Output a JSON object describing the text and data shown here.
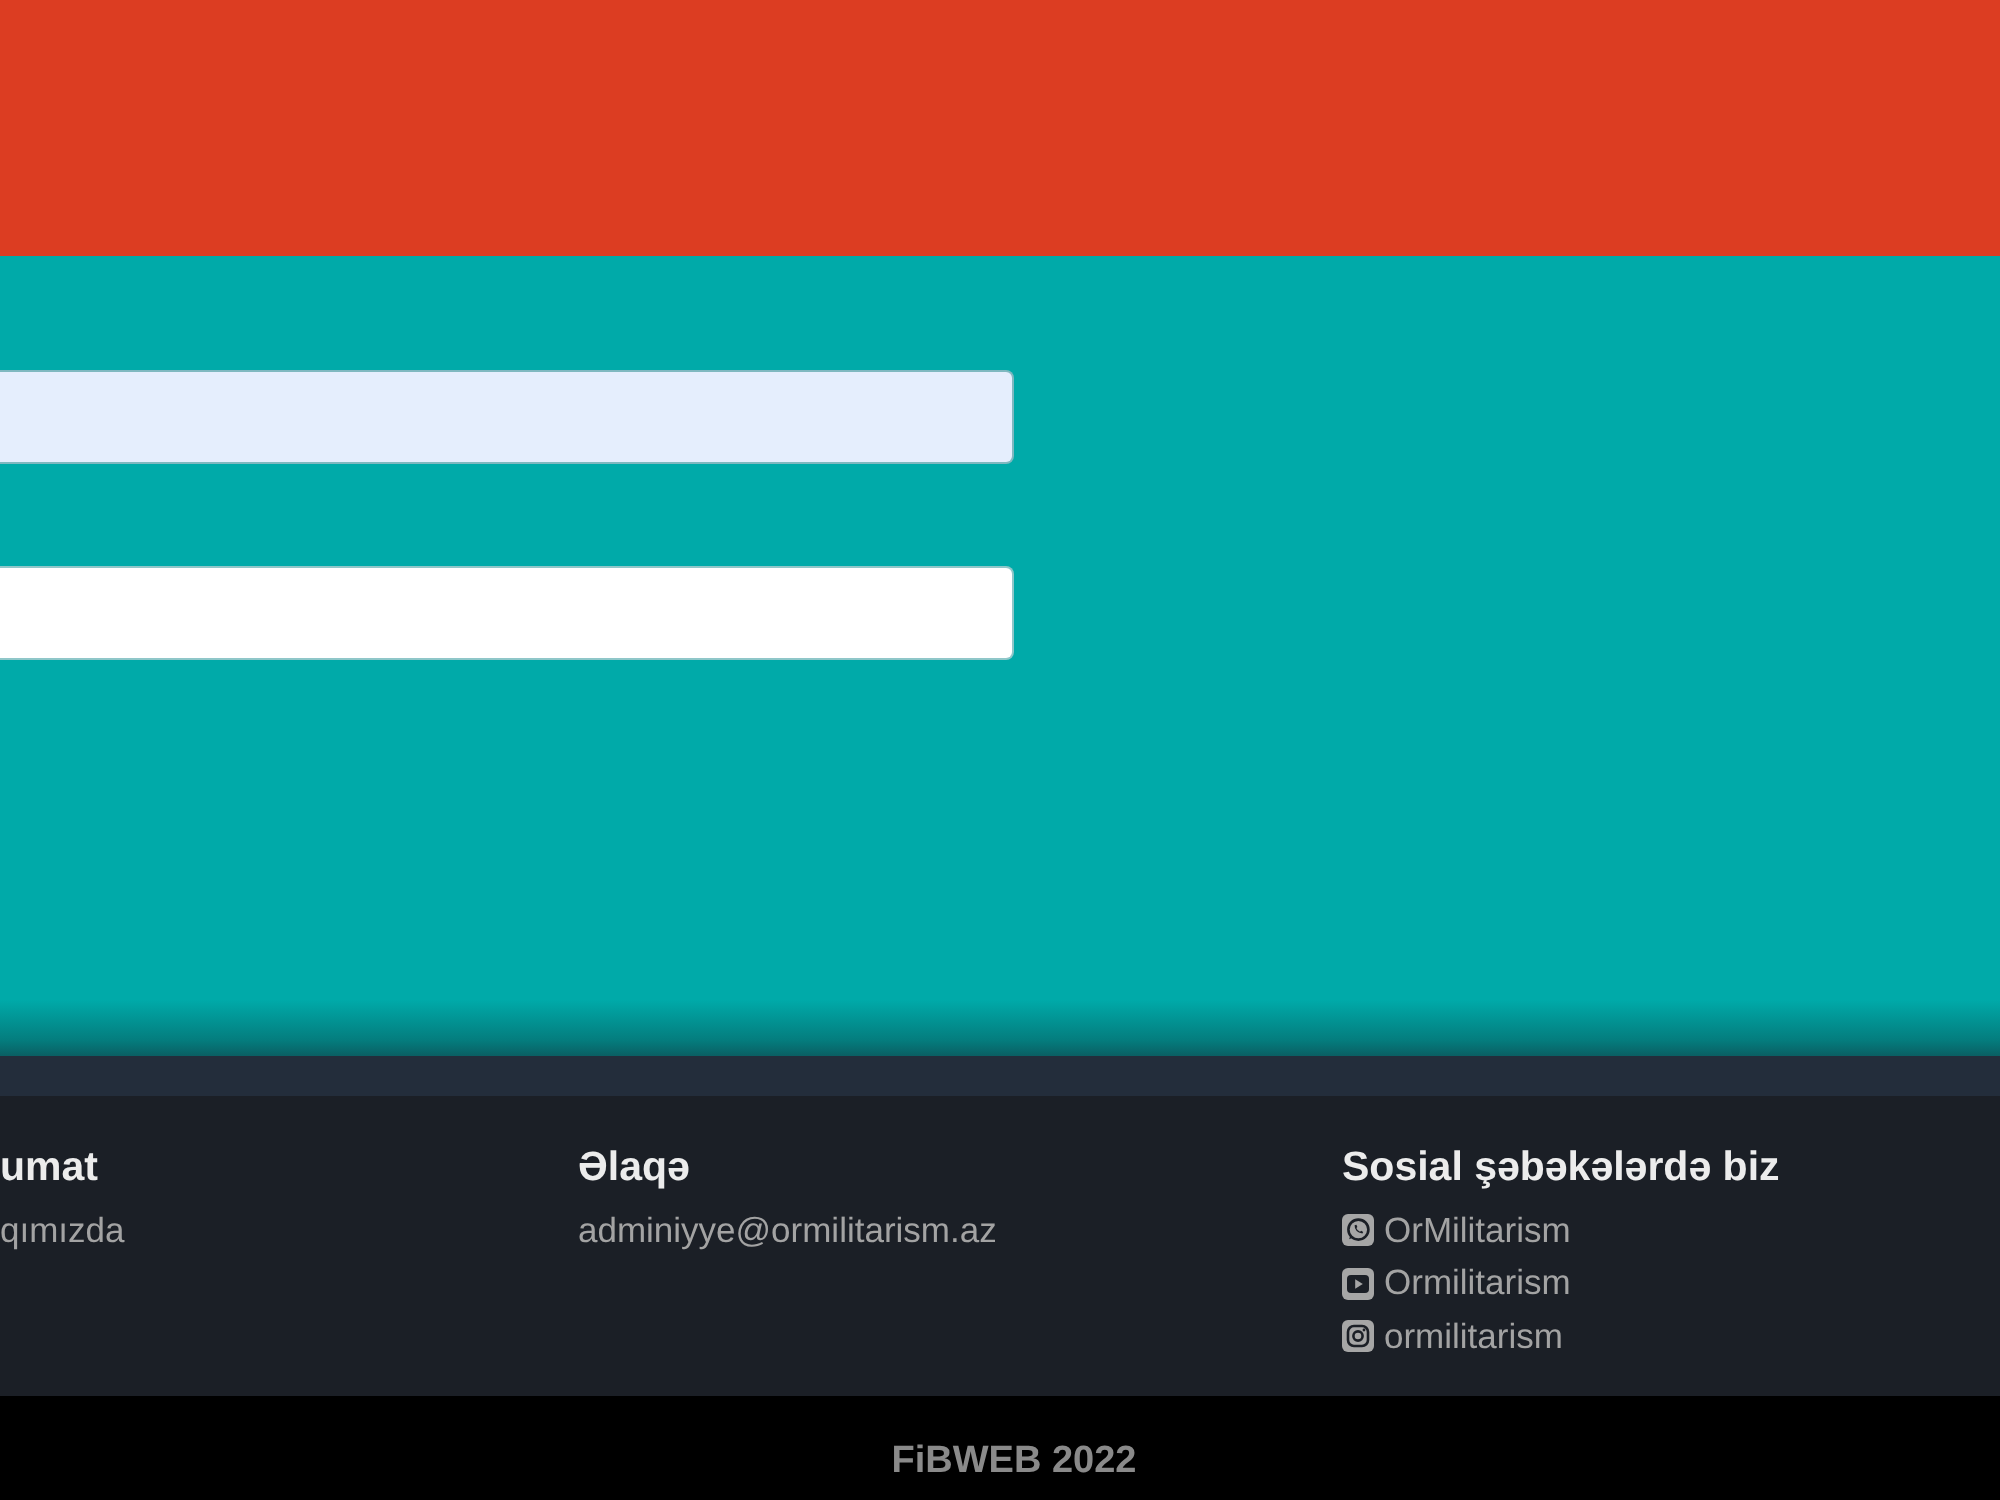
{
  "form": {
    "fields": [
      {
        "autofilled": true
      },
      {
        "autofilled": false
      }
    ]
  },
  "footer": {
    "columns": [
      {
        "heading": "umat",
        "items": [
          {
            "kind": "text",
            "label": "qımızda"
          }
        ]
      },
      {
        "heading": "Əlaqə",
        "items": [
          {
            "kind": "text",
            "label": "adminiyye@ormilitarism.az"
          }
        ]
      },
      {
        "heading": "Sosial şəbəkələrdə biz",
        "items": [
          {
            "kind": "chat",
            "label": "OrMilitarism"
          },
          {
            "kind": "play",
            "label": "Ormilitarism"
          },
          {
            "kind": "camera",
            "label": "ormilitarism"
          }
        ]
      }
    ]
  },
  "copyright": "FiBWEB 2022"
}
